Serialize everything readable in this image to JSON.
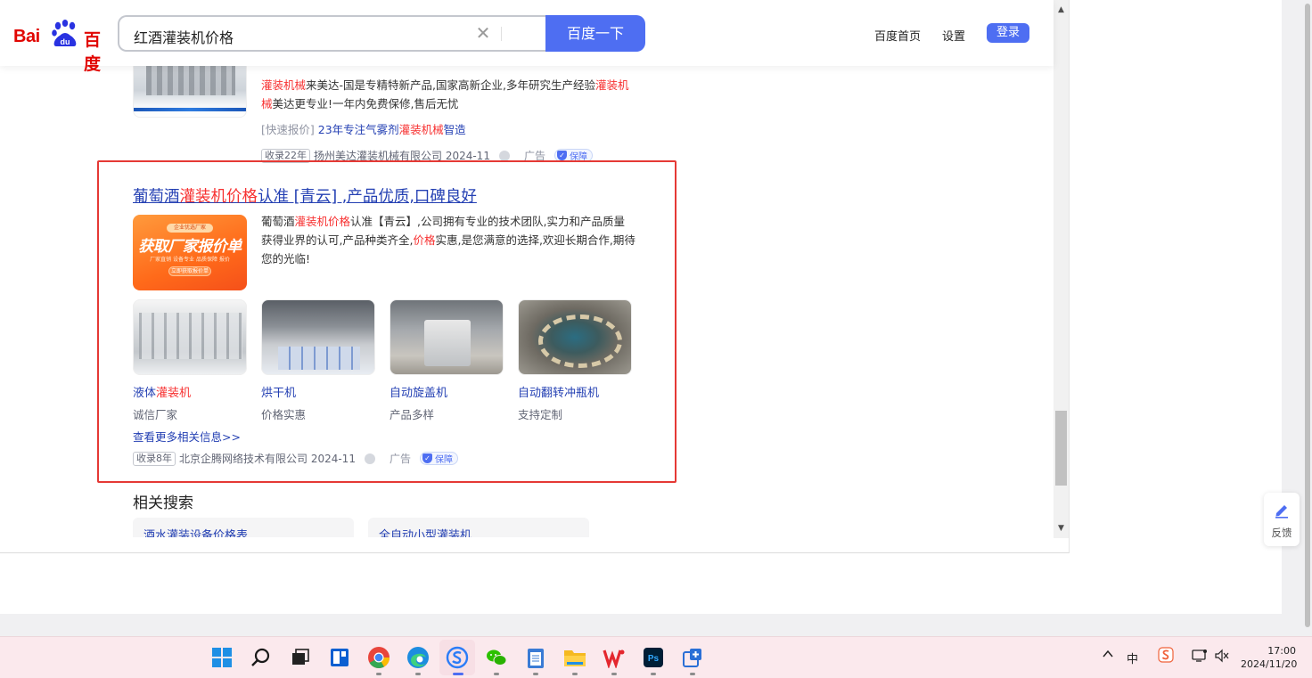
{
  "header": {
    "logo_text_bai": "Bai",
    "logo_text_cn": "百度",
    "search_value": "红酒灌装机价格",
    "search_button": "百度一下",
    "nav_home": "百度首页",
    "nav_settings": "设置",
    "login": "登录"
  },
  "result_prev": {
    "desc_red1": "灌装机械",
    "desc_mid": "来美达-国是专精特新产品,国家高新企业,多年研究生产经验",
    "desc_red2": "灌装机械",
    "desc_end": "美达更专业!一年内免费保修,售后无忧",
    "quick_tag": "[快速报价]",
    "quick_pre": "23年专注气雾剂",
    "quick_red": "灌装机械",
    "quick_post": "智造",
    "meta_tag": "收录22年",
    "meta_company": "扬州美达灌装机械有限公司 2024-11",
    "meta_ad": "广告",
    "meta_guarantee": "保障"
  },
  "ad_result": {
    "title_pre": "葡萄酒",
    "title_red": "灌装机价格",
    "title_post": "认准 [青云] ,产品优质,口碑良好",
    "image": {
      "badge": "企业优选厂家",
      "headline": "获取厂家报价单",
      "subline": "厂家直销 设备专业 品质保障 报价",
      "button": "立即获取报价单"
    },
    "desc_pre": "葡萄酒",
    "desc_red1": "灌装机价格",
    "desc_mid": "认准【青云】,公司拥有专业的技术团队,实力和产品质量获得业界的认可,产品种类齐全,",
    "desc_red2": "价格",
    "desc_end": "实惠,是您满意的选择,欢迎长期合作,期待您的光临!",
    "products": [
      {
        "name_pre": "液体",
        "name_red": "灌装机",
        "sub": "诚信厂家"
      },
      {
        "name_pre": "烘干机",
        "name_red": "",
        "sub": "价格实惠"
      },
      {
        "name_pre": "自动旋盖机",
        "name_red": "",
        "sub": "产品多样"
      },
      {
        "name_pre": "自动翻转冲瓶机",
        "name_red": "",
        "sub": "支持定制"
      }
    ],
    "more_link": "查看更多相关信息>>",
    "meta_tag": "收录8年",
    "meta_company": "北京企腾网络技术有限公司 2024-11",
    "meta_ad": "广告",
    "meta_guarantee": "保障"
  },
  "related": {
    "title": "相关搜索",
    "items": [
      "酒水灌装设备价格表",
      "全自动小型灌装机"
    ]
  },
  "feedback": {
    "label": "反馈"
  },
  "taskbar": {
    "apps": [
      "start-icon",
      "search-icon",
      "task-view-icon",
      "widgets-icon",
      "chrome-icon",
      "edge-icon",
      "sogou-browser-icon",
      "wechat-icon",
      "notepad-icon",
      "file-explorer-icon",
      "wps-icon",
      "photoshop-icon",
      "snipping-tool-icon"
    ],
    "tray_ime": "中",
    "time": "17:00",
    "date": "2024/11/20"
  },
  "colors": {
    "accent": "#4e6ef2",
    "link": "#2440b3",
    "highlight": "#f73131",
    "annotation_box": "#e53935"
  }
}
